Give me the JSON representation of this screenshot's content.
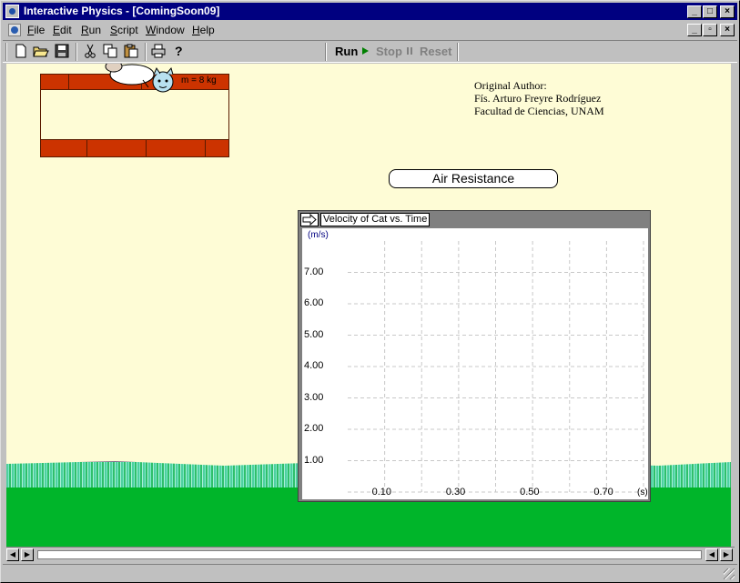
{
  "window": {
    "title": "Interactive Physics - [ComingSoon09]",
    "minimize": "_",
    "maximize": "□",
    "close": "×"
  },
  "menu": {
    "items": [
      "File",
      "Edit",
      "Run",
      "Script",
      "Window",
      "Help"
    ],
    "mdi_minimize": "_",
    "mdi_restore": "▫",
    "mdi_close": "×"
  },
  "toolbar": {
    "icons": [
      "new-file-icon",
      "open-folder-icon",
      "save-disk-icon",
      "cut-scissors-icon",
      "copy-icon",
      "paste-icon",
      "print-icon",
      "help-icon"
    ],
    "run_label": "Run",
    "stop_label": "Stop",
    "reset_label": "Reset"
  },
  "scene": {
    "mass_label": "m = 8 kg",
    "author_lines": [
      "Original Author:",
      "Fís. Arturo Freyre Rodríguez",
      "Facultad de Ciencias, UNAM"
    ],
    "air_button_label": "Air Resistance",
    "colors": {
      "background": "#fefcd6",
      "brick": "#cc3300",
      "ground": "#00b52a"
    }
  },
  "chart_data": {
    "type": "line",
    "title": "Velocity of Cat vs. Time",
    "ylabel": "(m/s)",
    "xlabel": "(s)",
    "yticks": [
      "7.00",
      "6.00",
      "5.00",
      "4.00",
      "3.00",
      "2.00",
      "1.00"
    ],
    "xticks": [
      "0.10",
      "0.30",
      "0.50",
      "0.70"
    ],
    "ylim": [
      0,
      8
    ],
    "xlim": [
      0,
      0.8
    ],
    "grid": true,
    "series": []
  }
}
